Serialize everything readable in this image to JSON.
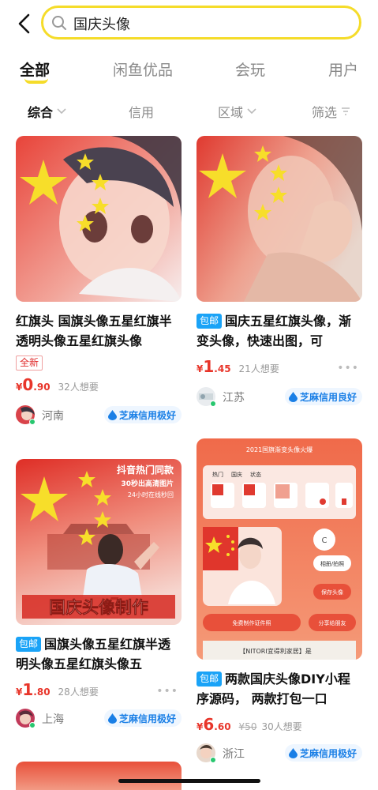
{
  "search": {
    "query": "国庆头像"
  },
  "tabs": [
    {
      "label": "全部"
    },
    {
      "label": "闲鱼优品"
    },
    {
      "label": "会玩"
    },
    {
      "label": "用户"
    }
  ],
  "filters": [
    {
      "label": "综合"
    },
    {
      "label": "信用"
    },
    {
      "label": "区域"
    },
    {
      "label": "筛选"
    }
  ],
  "colors": {
    "accent_yellow": "#f5dc2a",
    "price_red": "#e8352a",
    "credit_blue": "#1a7fe6",
    "mail_blue": "#1aa3f7"
  },
  "items": [
    {
      "title": "红旗头  国旗头像五星红旗半透明头像五星红旗头像",
      "badge": "",
      "tag": "全新",
      "price_symbol": "¥",
      "price_int": "0",
      "price_dec": ".90",
      "original_price": "",
      "wants": "32人想要",
      "region": "河南",
      "credit": "芝麻信用极好"
    },
    {
      "title": "国庆五星红旗头像，渐变头像，快速出图，可",
      "badge": "包邮",
      "tag": "",
      "price_symbol": "¥",
      "price_int": "1",
      "price_dec": ".45",
      "original_price": "",
      "wants": "21人想要",
      "region": "江苏",
      "credit": "芝麻信用良好"
    },
    {
      "title": "国旗头像五星红旗半透明头像五星红旗头像五",
      "badge": "包邮",
      "tag": "",
      "price_symbol": "¥",
      "price_int": "1",
      "price_dec": ".80",
      "original_price": "",
      "wants": "28人想要",
      "region": "上海",
      "credit": "芝麻信用极好",
      "image_text": {
        "line1": "抖音热门同款",
        "line2": "30秒出高清图片",
        "line3": "24小时在线秒回",
        "banner": "国庆头像制作"
      }
    },
    {
      "title": "两款国庆头像DIY小程序源码， 两款打包一口",
      "badge": "包邮",
      "tag": "",
      "price_symbol": "¥",
      "price_int": "6",
      "price_dec": ".60",
      "original_price": "¥50",
      "wants": "30人想要",
      "region": "浙江",
      "credit": "芝麻信用极好",
      "image_text": {
        "heading": "2021国旗渐变头像火爆",
        "tab_hot": "热门",
        "tab_country": "国庆",
        "tab_status": "状态",
        "album": "相册/拍照",
        "save": "保存头像",
        "make_id": "免费制作证件照",
        "share": "分享给朋友",
        "footer_note": "【NITORI宜得利家居】是"
      }
    }
  ]
}
